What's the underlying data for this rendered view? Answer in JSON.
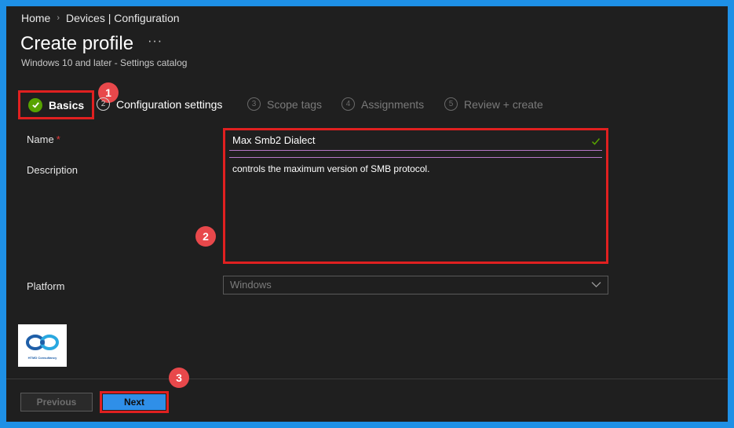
{
  "breadcrumb": {
    "home": "Home",
    "current": "Devices | Configuration"
  },
  "header": {
    "title": "Create profile",
    "more": "···",
    "subtitle": "Windows 10 and later - Settings catalog"
  },
  "steps": [
    {
      "num": "1",
      "label": "Basics",
      "state": "complete"
    },
    {
      "num": "2",
      "label": "Configuration settings",
      "state": "active"
    },
    {
      "num": "3",
      "label": "Scope tags",
      "state": "pending"
    },
    {
      "num": "4",
      "label": "Assignments",
      "state": "pending"
    },
    {
      "num": "5",
      "label": "Review + create",
      "state": "pending"
    }
  ],
  "form": {
    "name_label": "Name",
    "required_mark": "*",
    "name_value": "Max Smb2 Dialect",
    "description_label": "Description",
    "description_value": "controls the maximum version of SMB protocol.",
    "platform_label": "Platform",
    "platform_value": "Windows"
  },
  "annotations": {
    "one": "1",
    "two": "2",
    "three": "3"
  },
  "logo": {
    "text": "HTMD Consultancy"
  },
  "footer": {
    "previous_label": "Previous",
    "next_label": "Next"
  },
  "colors": {
    "accent": "#2f8fe8",
    "success": "#57a300",
    "highlight": "#e02020",
    "badge": "#e8484b",
    "focus_underline": "#b878c8"
  }
}
